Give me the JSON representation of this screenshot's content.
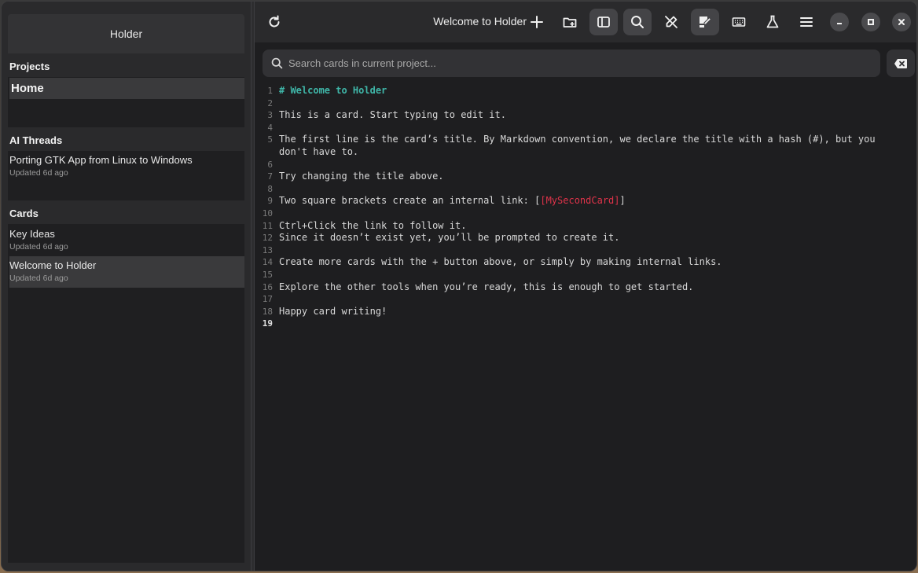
{
  "sidebar": {
    "header_title": "Holder",
    "projects_title": "Projects",
    "projects": [
      {
        "label": "Home"
      }
    ],
    "ai_threads_title": "AI Threads",
    "ai_threads": [
      {
        "title": "Porting GTK App from Linux to Windows",
        "updated": "Updated 6d ago"
      }
    ],
    "cards_title": "Cards",
    "cards": [
      {
        "title": "Key Ideas",
        "updated": "Updated 6d ago"
      },
      {
        "title": "Welcome to Holder",
        "updated": "Updated 6d ago"
      }
    ],
    "selected_card": "Welcome to Holder"
  },
  "headerbar": {
    "title": "Welcome to Holder",
    "icons": [
      "refresh-icon",
      "plus-icon",
      "folder-add-icon",
      "sidebar-toggle-icon",
      "search-icon",
      "pen-off-icon",
      "notes-icon",
      "keyboard-icon",
      "flask-icon",
      "menu-icon",
      "minimize-icon",
      "maximize-icon",
      "close-icon"
    ]
  },
  "search": {
    "placeholder": "Search cards in current project...",
    "value": ""
  },
  "editor": {
    "current_line": 19,
    "lines": [
      {
        "n": "1",
        "parts": [
          {
            "t": "# Welcome to Holder",
            "k": "heading"
          }
        ]
      },
      {
        "n": "2",
        "parts": []
      },
      {
        "n": "3",
        "parts": [
          {
            "t": "This is a card. Start typing to edit it.",
            "k": "text"
          }
        ]
      },
      {
        "n": "4",
        "parts": []
      },
      {
        "n": "5",
        "parts": [
          {
            "t": "The first line is the card’s title. By Markdown convention, we declare the title with a hash (#), but you don't have to.",
            "k": "text"
          }
        ],
        "wrap": true
      },
      {
        "n": "6",
        "parts": []
      },
      {
        "n": "7",
        "parts": [
          {
            "t": "Try changing the title above.",
            "k": "text"
          }
        ]
      },
      {
        "n": "8",
        "parts": []
      },
      {
        "n": "9",
        "parts": [
          {
            "t": "Two square brackets create an internal link: [",
            "k": "text"
          },
          {
            "t": "[MySecondCard]",
            "k": "link"
          },
          {
            "t": "]",
            "k": "text"
          }
        ]
      },
      {
        "n": "10",
        "parts": []
      },
      {
        "n": "11",
        "parts": [
          {
            "t": "Ctrl+Click the link to follow it.",
            "k": "text"
          }
        ]
      },
      {
        "n": "12",
        "parts": [
          {
            "t": "Since it doesn’t exist yet, you’ll be prompted to create it.",
            "k": "text"
          }
        ]
      },
      {
        "n": "13",
        "parts": []
      },
      {
        "n": "14",
        "parts": [
          {
            "t": "Create more cards with the + button above, or simply by making internal links.",
            "k": "text"
          }
        ]
      },
      {
        "n": "15",
        "parts": []
      },
      {
        "n": "16",
        "parts": [
          {
            "t": "Explore the other tools when you’re ready, this is enough to get started.",
            "k": "text"
          }
        ]
      },
      {
        "n": "17",
        "parts": []
      },
      {
        "n": "18",
        "parts": [
          {
            "t": "Happy card writing!",
            "k": "text"
          }
        ]
      },
      {
        "n": "19",
        "parts": []
      }
    ]
  },
  "colors": {
    "heading": "#3fb6a8",
    "link": "#e0334a",
    "background": "#1e1e20",
    "sidebar": "#2a2a2c"
  }
}
